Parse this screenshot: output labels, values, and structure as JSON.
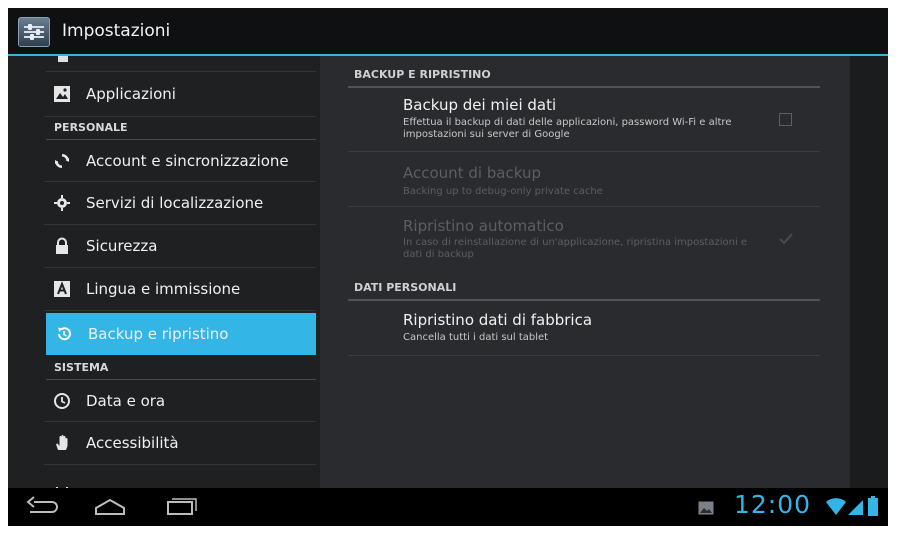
{
  "actionbar": {
    "title": "Impostazioni"
  },
  "sidebar": {
    "items": [
      {
        "label": "Applicazioni",
        "icon": "apps-icon"
      },
      {
        "header": "PERSONALE"
      },
      {
        "label": "Account e sincronizzazione",
        "icon": "sync-icon"
      },
      {
        "label": "Servizi di localizzazione",
        "icon": "location-icon"
      },
      {
        "label": "Sicurezza",
        "icon": "lock-icon"
      },
      {
        "label": "Lingua e immissione",
        "icon": "language-icon"
      },
      {
        "label": "Backup e ripristino",
        "icon": "backup-icon",
        "selected": true
      },
      {
        "header": "SISTEMA"
      },
      {
        "label": "Data e ora",
        "icon": "clock-icon"
      },
      {
        "label": "Accessibilità",
        "icon": "hand-icon"
      }
    ]
  },
  "main": {
    "sections": [
      {
        "header": "BACKUP E RIPRISTINO",
        "items": [
          {
            "title": "Backup dei miei dati",
            "summary": "Effettua il backup di dati delle applicazioni, password Wi-Fi e altre impostazioni sui server di Google",
            "checked": false,
            "enabled": true
          },
          {
            "title": "Account di backup",
            "summary": "Backing up to debug-only private cache",
            "enabled": false
          },
          {
            "title": "Ripristino automatico",
            "summary": "In caso di reinstallazione di un'applicazione, ripristina impostazioni e dati di backup",
            "checked": true,
            "enabled": false
          }
        ]
      },
      {
        "header": "DATI PERSONALI",
        "items": [
          {
            "title": "Ripristino dati di fabbrica",
            "summary": "Cancella tutti i dati sul tablet",
            "enabled": true
          }
        ]
      }
    ]
  },
  "navbar": {
    "clock": "12:00",
    "accent_color": "#33b5e5"
  },
  "colors": {
    "accent": "#33b5e5",
    "selected_row": "#33b5e5"
  }
}
